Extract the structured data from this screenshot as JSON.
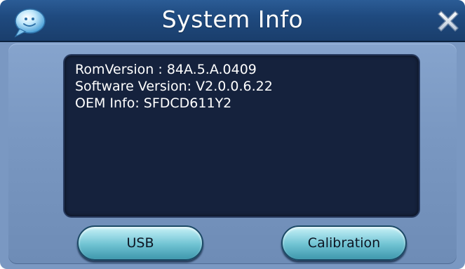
{
  "window": {
    "title": "System Info",
    "logo_icon": "chat-bubble-smiley-icon",
    "close_icon": "close-x-icon"
  },
  "info": {
    "lines": [
      "RomVersion : 84A.5.A.0409",
      "Software Version: V2.0.0.6.22",
      "OEM Info: SFDCD611Y2"
    ]
  },
  "buttons": {
    "usb_label": "USB",
    "calibration_label": "Calibration"
  },
  "colors": {
    "title_bar": "#1f4a7f",
    "panel": "#7a98c2",
    "screen": "#15223d",
    "button": "#6fc2d2",
    "text_light": "#ffffff"
  }
}
